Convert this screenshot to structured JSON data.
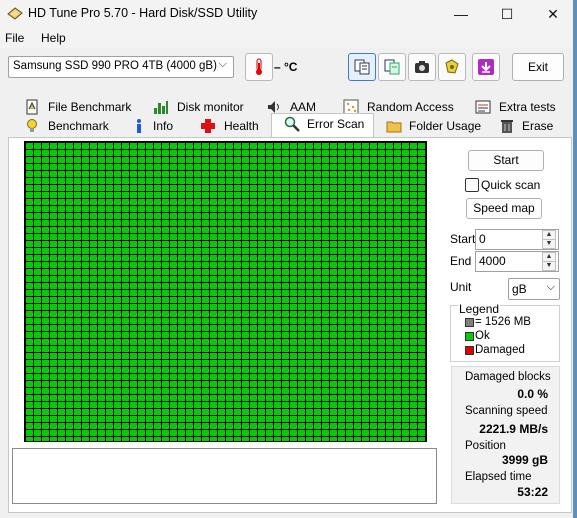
{
  "window": {
    "title": "HD Tune Pro 5.70 - Hard Disk/SSD Utility",
    "minimize": "—",
    "maximize": "☐",
    "close": "✕"
  },
  "menu": {
    "file": "File",
    "help": "Help"
  },
  "toolbar": {
    "drive": "Samsung SSD 990 PRO 4TB (4000 gB)",
    "temperature": "– °C",
    "exit_label": "Exit",
    "icons": [
      "thermometer-icon",
      "copy-text-icon",
      "copy-info-icon",
      "screenshot-icon",
      "options-icon",
      "save-icon"
    ]
  },
  "tabs": {
    "row1": [
      "File Benchmark",
      "Disk monitor",
      "AAM",
      "Random Access",
      "Extra tests"
    ],
    "row2": [
      "Benchmark",
      "Info",
      "Health",
      "Error Scan",
      "Folder Usage",
      "Erase"
    ],
    "active": "Error Scan"
  },
  "scan": {
    "grid_color": "#09c909",
    "start_label": "Start",
    "quick_scan_label": "Quick scan",
    "quick_scan_checked": false,
    "speed_map_label": "Speed map",
    "start_field_label": "Start",
    "start_value": "0",
    "end_field_label": "End",
    "end_value": "4000",
    "unit_label": "Unit",
    "unit_value": "gB"
  },
  "legend": {
    "title": "Legend",
    "block_size": "= 1526 MB",
    "ok": "Ok",
    "damaged": "Damaged",
    "colors": {
      "block": "#808080",
      "ok": "#09c909",
      "damaged": "#e00000"
    }
  },
  "stats": {
    "damaged_blocks_label": "Damaged blocks",
    "damaged_blocks_value": "0.0 %",
    "scanning_speed_label": "Scanning speed",
    "scanning_speed_value": "2221.9 MB/s",
    "position_label": "Position",
    "position_value": "3999 gB",
    "elapsed_label": "Elapsed time",
    "elapsed_value": "53:22"
  }
}
